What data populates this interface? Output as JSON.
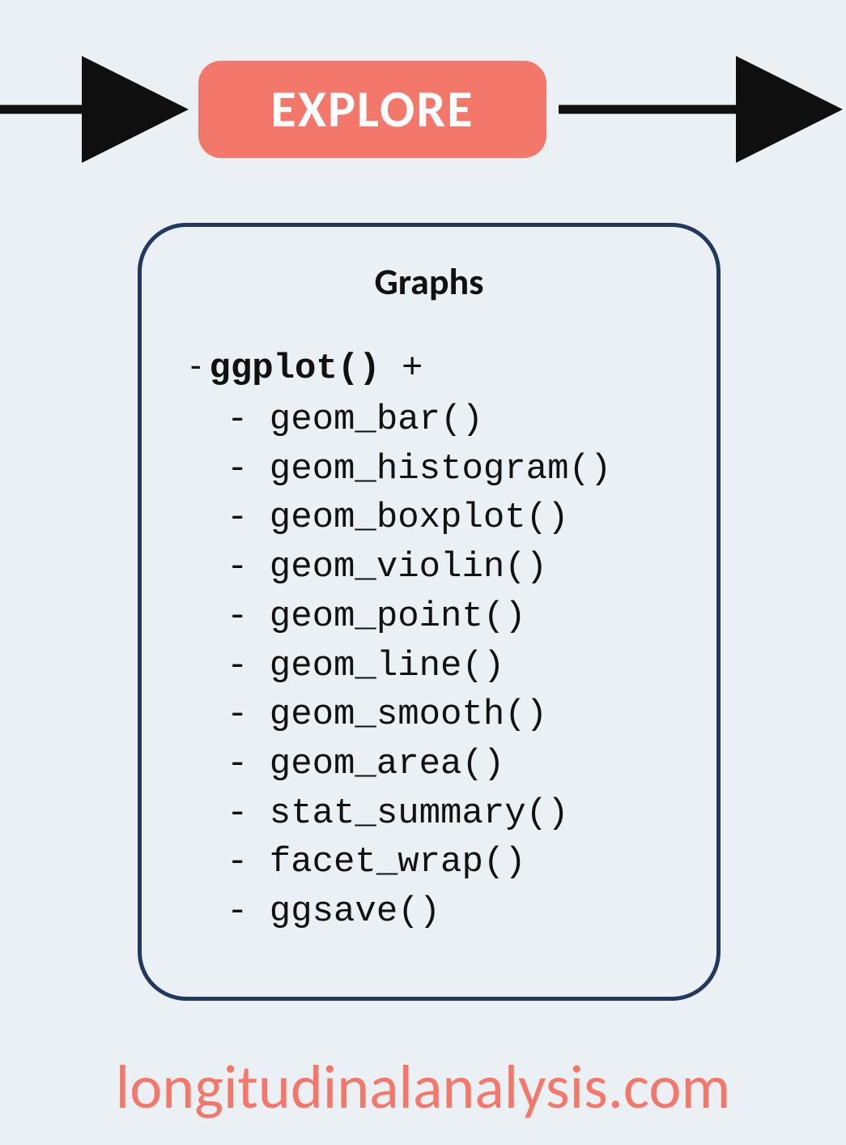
{
  "badge": {
    "label": "EXPLORE"
  },
  "card": {
    "title": "Graphs",
    "main_function": "ggplot()",
    "main_suffix": " +",
    "items": [
      "geom_bar()",
      "geom_histogram()",
      "geom_boxplot()",
      "geom_violin()",
      "geom_point()",
      "geom_line()",
      "geom_smooth()",
      "geom_area()",
      "stat_summary()",
      "facet_wrap()",
      "ggsave()"
    ]
  },
  "footer": "longitudinalanalysis.com",
  "colors": {
    "background": "#eaf0f4",
    "accent": "#f3776a",
    "border": "#22385c",
    "arrow": "#0f0f0f"
  }
}
